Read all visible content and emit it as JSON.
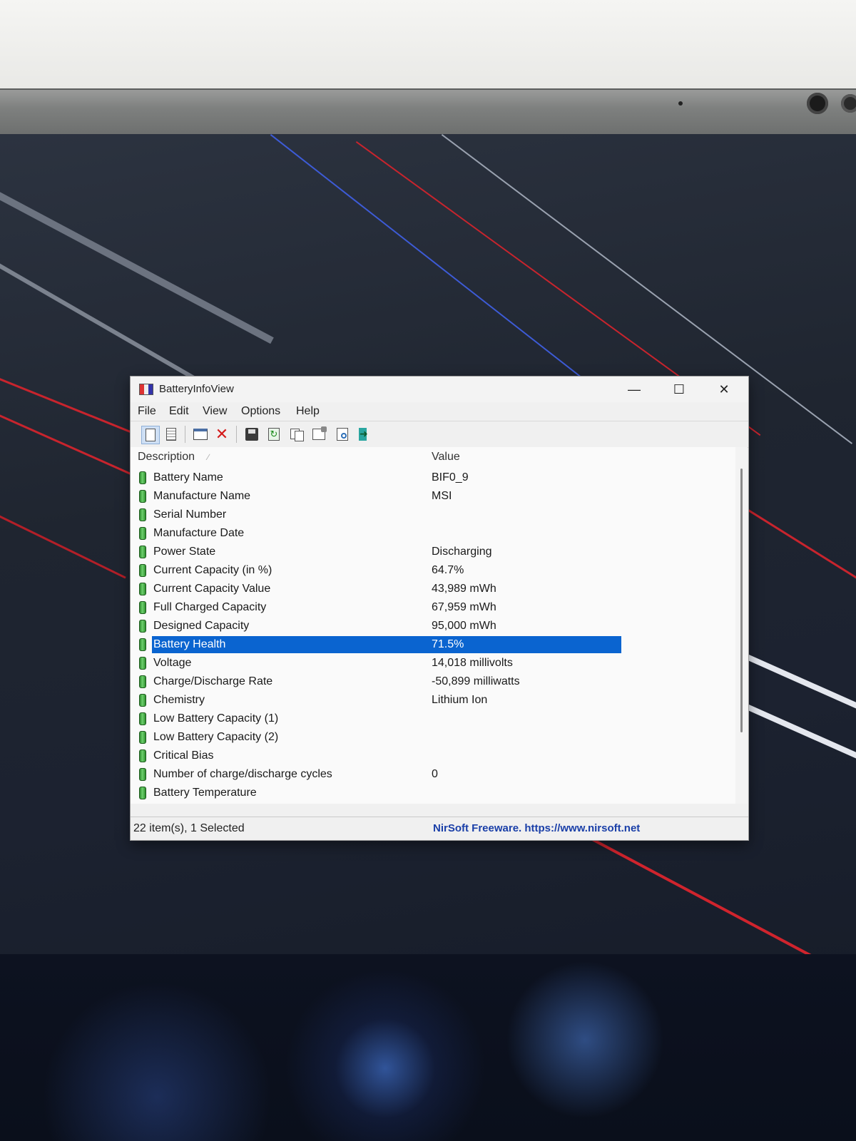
{
  "colors": {
    "selection": "#0a64d0",
    "link": "#1a3fa8",
    "delete_icon": "#d41b1b",
    "battery_icon": "#3aa83a"
  },
  "window": {
    "title": "BatteryInfoView",
    "controls": {
      "minimize": "—",
      "maximize": "☐",
      "close": "✕"
    }
  },
  "menu": [
    "File",
    "Edit",
    "View",
    "Options",
    "Help"
  ],
  "toolbar": {
    "icons": [
      "page-icon",
      "page-lines-icon",
      "window-icon",
      "delete-icon",
      "save-disk-icon",
      "refresh-icon",
      "copy-icon",
      "properties-icon",
      "find-icon",
      "exit-icon"
    ],
    "refresh_glyph": "↻"
  },
  "list": {
    "columns": [
      "Description",
      "Value"
    ],
    "sort_indicator": "∕",
    "selected_index": 9,
    "rows": [
      {
        "description": "Battery Name",
        "value": "BIF0_9"
      },
      {
        "description": "Manufacture Name",
        "value": "MSI"
      },
      {
        "description": "Serial Number",
        "value": ""
      },
      {
        "description": "Manufacture Date",
        "value": ""
      },
      {
        "description": "Power State",
        "value": "Discharging"
      },
      {
        "description": "Current Capacity (in %)",
        "value": "64.7%"
      },
      {
        "description": "Current Capacity Value",
        "value": "43,989 mWh"
      },
      {
        "description": "Full Charged Capacity",
        "value": "67,959 mWh"
      },
      {
        "description": "Designed Capacity",
        "value": "95,000 mWh"
      },
      {
        "description": "Battery Health",
        "value": "71.5%"
      },
      {
        "description": "Voltage",
        "value": "14,018 millivolts"
      },
      {
        "description": "Charge/Discharge Rate",
        "value": "-50,899 milliwatts"
      },
      {
        "description": "Chemistry",
        "value": "Lithium Ion"
      },
      {
        "description": "Low Battery Capacity (1)",
        "value": ""
      },
      {
        "description": "Low Battery Capacity (2)",
        "value": ""
      },
      {
        "description": "Critical Bias",
        "value": ""
      },
      {
        "description": "Number of charge/discharge cycles",
        "value": "0"
      },
      {
        "description": "Battery Temperature",
        "value": ""
      }
    ]
  },
  "status": {
    "items": "22 item(s), 1 Selected",
    "link": "NirSoft Freeware. https://www.nirsoft.net"
  }
}
